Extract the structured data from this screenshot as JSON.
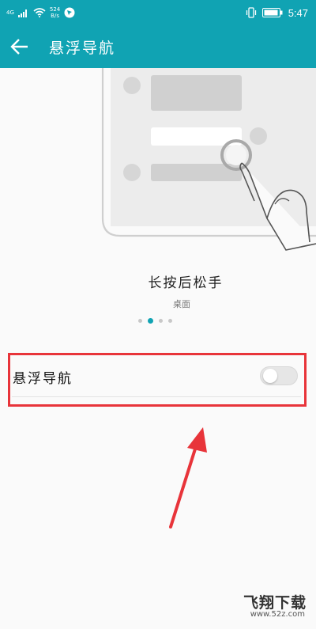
{
  "status_bar": {
    "network": "4G",
    "speed_value": "524",
    "speed_unit": "B/s",
    "time": "5:47"
  },
  "app_bar": {
    "title": "悬浮导航"
  },
  "guide": {
    "title": "长按后松手",
    "subtitle": "桌面",
    "page_count": 4,
    "active_page": 2
  },
  "setting": {
    "label": "悬浮导航",
    "enabled": false
  },
  "watermark": {
    "title": "飞翔下载",
    "url": "www.52z.com"
  },
  "colors": {
    "header": "#10a3b3",
    "highlight": "#e8343a"
  }
}
